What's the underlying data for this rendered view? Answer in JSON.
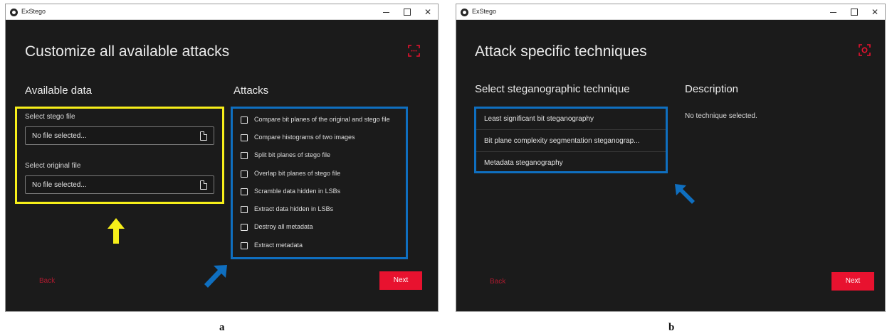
{
  "window_a": {
    "title": "ExStego",
    "controls": {
      "minimize": "",
      "maximize": "",
      "close": "✕"
    },
    "heading": "Customize all available attacks",
    "available_data": {
      "title": "Available data",
      "stego_label": "Select stego file",
      "stego_value": "No file selected...",
      "original_label": "Select original file",
      "original_value": "No file selected..."
    },
    "attacks": {
      "title": "Attacks",
      "items": [
        "Compare bit planes of the original and stego file",
        "Compare histograms of two images",
        "Split bit planes of stego file",
        "Overlap bit planes of stego file",
        "Scramble data hidden in LSBs",
        "Extract data hidden in LSBs",
        "Destroy all metadata",
        "Extract metadata"
      ]
    },
    "back_label": "Back",
    "next_label": "Next",
    "header_icon": "scan-dots-icon"
  },
  "window_b": {
    "title": "ExStego",
    "controls": {
      "minimize": "",
      "maximize": "",
      "close": "✕"
    },
    "heading": "Attack specific techniques",
    "technique_title": "Select steganographic technique",
    "techniques": [
      "Least significant bit steganography",
      "Bit plane complexity segmentation steganograp...",
      "Metadata steganography"
    ],
    "description_title": "Description",
    "description_text": "No technique selected.",
    "back_label": "Back",
    "next_label": "Next",
    "header_icon": "scan-target-icon"
  },
  "labels": {
    "panel_a": "a",
    "panel_b": "b"
  },
  "colors": {
    "background": "#1b1b1b",
    "accent_red": "#e8122f",
    "back_red": "#b01a2f",
    "highlight_yellow": "#f7ef1a",
    "highlight_blue": "#0f6fc0"
  }
}
